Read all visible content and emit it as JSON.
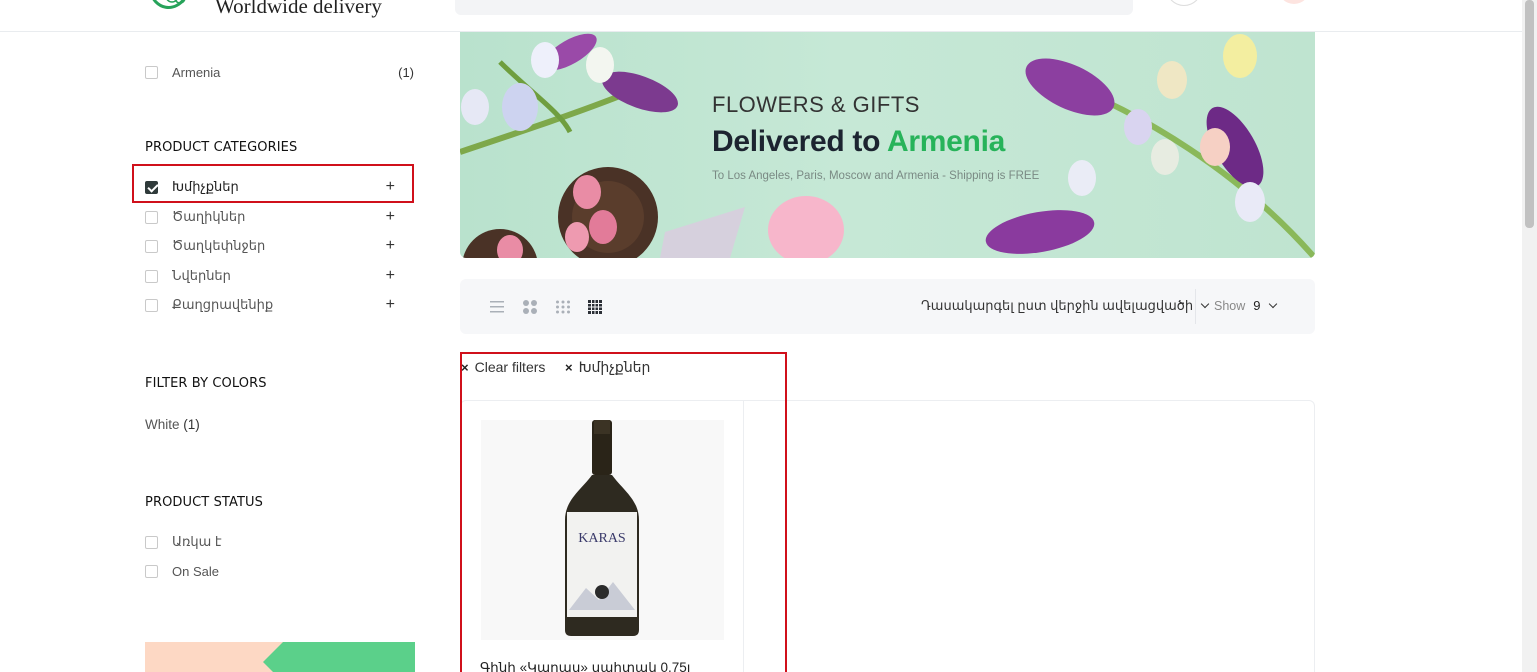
{
  "header": {
    "tagline": "Worldwide delivery"
  },
  "sidebar": {
    "location_filter": {
      "label": "Armenia",
      "count": "(1)",
      "checked": false
    },
    "categories_title": "PRODUCT CATEGORIES",
    "categories": [
      {
        "label": "Խմիչքներ",
        "checked": true,
        "expand": "+"
      },
      {
        "label": "Ծաղիկներ",
        "checked": false,
        "expand": "+"
      },
      {
        "label": "Ծաղկեփնջեր",
        "checked": false,
        "expand": "+"
      },
      {
        "label": "Նվերներ",
        "checked": false,
        "expand": "+"
      },
      {
        "label": "Քաղցրավենիք",
        "checked": false,
        "expand": "+"
      }
    ],
    "colors_title": "FILTER BY COLORS",
    "color_filter": {
      "label": "White",
      "count": "(1)"
    },
    "status_title": "PRODUCT STATUS",
    "statuses": [
      {
        "label": "Առկա է",
        "checked": false
      },
      {
        "label": "On Sale",
        "checked": false
      }
    ]
  },
  "hero": {
    "subtitle": "FLOWERS & GIFTS",
    "title_prefix": "Delivered to",
    "title_accent": "Armenia",
    "note": "To Los Angeles, Paris, Moscow and Armenia - Shipping is FREE",
    "colors": {
      "accent": "#27b35a",
      "background": "#c3e6d3"
    }
  },
  "toolbar": {
    "view_modes": [
      "list-view-icon",
      "grid-2-view-icon",
      "grid-3-view-icon",
      "grid-4-view-icon"
    ],
    "active_view": "grid-4-view-icon",
    "sort_label": "Դասակարգել ըստ վերջին ավելացվածի",
    "show_label": "Show",
    "show_value": "9"
  },
  "active_filters": [
    {
      "label": "Clear filters"
    },
    {
      "label": "Խմիչքներ"
    }
  ],
  "products": [
    {
      "title": "Գինի «Կարաս» սպիտակ 0.75լ",
      "image": "wine-bottle-karas"
    }
  ],
  "colors": {
    "highlight": "#d0101b"
  }
}
